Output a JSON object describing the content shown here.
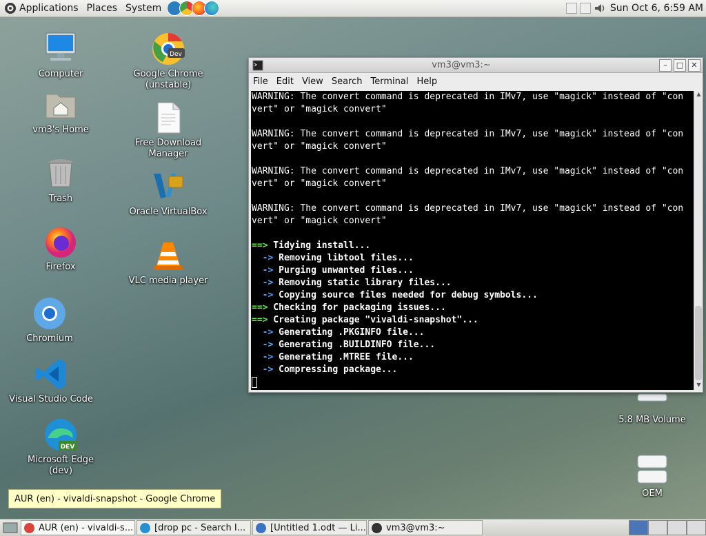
{
  "top_panel": {
    "menus": [
      "Applications",
      "Places",
      "System"
    ],
    "launchers": [
      {
        "icon": "virtualbox-icon",
        "color": "#2b7fc1"
      },
      {
        "icon": "chrome-dev-icon",
        "color": "#e53935"
      },
      {
        "icon": "firefox-icon",
        "color": "#ff7a1a"
      },
      {
        "icon": "edge-dev-icon",
        "color": "#2aa9a0"
      }
    ],
    "clock": "Sun Oct  6,  6:59 AM"
  },
  "desktop": {
    "icons": [
      {
        "label": "Computer",
        "icon": "computer-icon"
      },
      {
        "label": "vm3's Home",
        "icon": "home-folder-icon"
      },
      {
        "label": "Trash",
        "icon": "trash-icon"
      },
      {
        "label": "Firefox",
        "icon": "firefox-icon"
      },
      {
        "label": "Chromium",
        "icon": "chromium-icon"
      },
      {
        "label": "Visual Studio Code",
        "icon": "vscode-icon"
      },
      {
        "label": "Microsoft Edge (dev)",
        "icon": "edge-dev-icon"
      },
      {
        "label": "Google Chrome (unstable)",
        "icon": "chrome-dev-icon"
      },
      {
        "label": "Free Download Manager",
        "icon": "document-icon"
      },
      {
        "label": "Oracle VirtualBox",
        "icon": "virtualbox-icon"
      },
      {
        "label": "VLC media player",
        "icon": "vlc-icon"
      },
      {
        "label": "5.8 MB Volume",
        "icon": "drive-icon"
      },
      {
        "label": "OEM",
        "icon": "drive-icon"
      }
    ]
  },
  "terminal": {
    "title": "vm3@vm3:~",
    "menu": [
      "File",
      "Edit",
      "View",
      "Search",
      "Terminal",
      "Help"
    ],
    "lines": [
      {
        "text": "WARNING: The convert command is deprecated in IMv7, use \"magick\" instead of \"con",
        "style": "n"
      },
      {
        "text": "vert\" or \"magick convert\"",
        "style": "n"
      },
      {
        "text": "",
        "style": "n"
      },
      {
        "text": "WARNING: The convert command is deprecated in IMv7, use \"magick\" instead of \"con",
        "style": "n"
      },
      {
        "text": "vert\" or \"magick convert\"",
        "style": "n"
      },
      {
        "text": "",
        "style": "n"
      },
      {
        "text": "WARNING: The convert command is deprecated in IMv7, use \"magick\" instead of \"con",
        "style": "n"
      },
      {
        "text": "vert\" or \"magick convert\"",
        "style": "n"
      },
      {
        "text": "",
        "style": "n"
      },
      {
        "text": "WARNING: The convert command is deprecated in IMv7, use \"magick\" instead of \"con",
        "style": "n"
      },
      {
        "text": "vert\" or \"magick convert\"",
        "style": "n"
      },
      {
        "text": "",
        "style": "n"
      },
      {
        "prefix": "==>",
        "text": " Tidying install...",
        "style": "g"
      },
      {
        "prefix": "  ->",
        "text": " Removing libtool files...",
        "style": "a"
      },
      {
        "prefix": "  ->",
        "text": " Purging unwanted files...",
        "style": "a"
      },
      {
        "prefix": "  ->",
        "text": " Removing static library files...",
        "style": "a"
      },
      {
        "prefix": "  ->",
        "text": " Copying source files needed for debug symbols...",
        "style": "a"
      },
      {
        "prefix": "==>",
        "text": " Checking for packaging issues...",
        "style": "g"
      },
      {
        "prefix": "==>",
        "text": " Creating package \"vivaldi-snapshot\"...",
        "style": "g"
      },
      {
        "prefix": "  ->",
        "text": " Generating .PKGINFO file...",
        "style": "a"
      },
      {
        "prefix": "  ->",
        "text": " Generating .BUILDINFO file...",
        "style": "a"
      },
      {
        "prefix": "  ->",
        "text": " Generating .MTREE file...",
        "style": "a"
      },
      {
        "prefix": "  ->",
        "text": " Compressing package...",
        "style": "a"
      }
    ]
  },
  "tooltip": "AUR (en) - vivaldi-snapshot - Google Chrome",
  "taskbar": {
    "tasks": [
      {
        "label": "AUR (en) - vivaldi-s...",
        "icon": "chrome-icon",
        "color": "#d9453b"
      },
      {
        "label": "[drop pc - Search I...",
        "icon": "edge-icon",
        "color": "#2a8fd0"
      },
      {
        "label": "[Untitled 1.odt — Li...",
        "icon": "writer-icon",
        "color": "#3a72c4"
      },
      {
        "label": "vm3@vm3:~",
        "icon": "terminal-icon",
        "color": "#333333"
      }
    ]
  }
}
